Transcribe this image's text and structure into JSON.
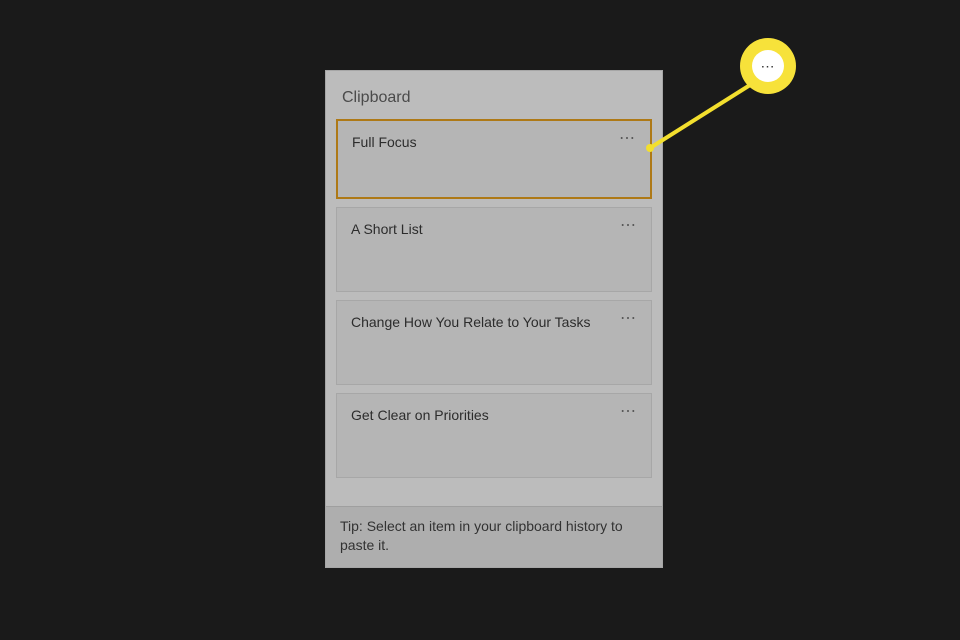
{
  "panel": {
    "title": "Clipboard",
    "tip": "Tip: Select an item in your clipboard history to paste it.",
    "more_glyph": "⋯"
  },
  "items": [
    {
      "text": "Full Focus",
      "selected": true
    },
    {
      "text": "A Short List",
      "selected": false
    },
    {
      "text": "Change How You Relate to Your Tasks",
      "selected": false
    },
    {
      "text": "Get Clear on Priorities",
      "selected": false
    }
  ],
  "callout": {
    "glyph": "⋯",
    "color": "#f7e23a"
  }
}
